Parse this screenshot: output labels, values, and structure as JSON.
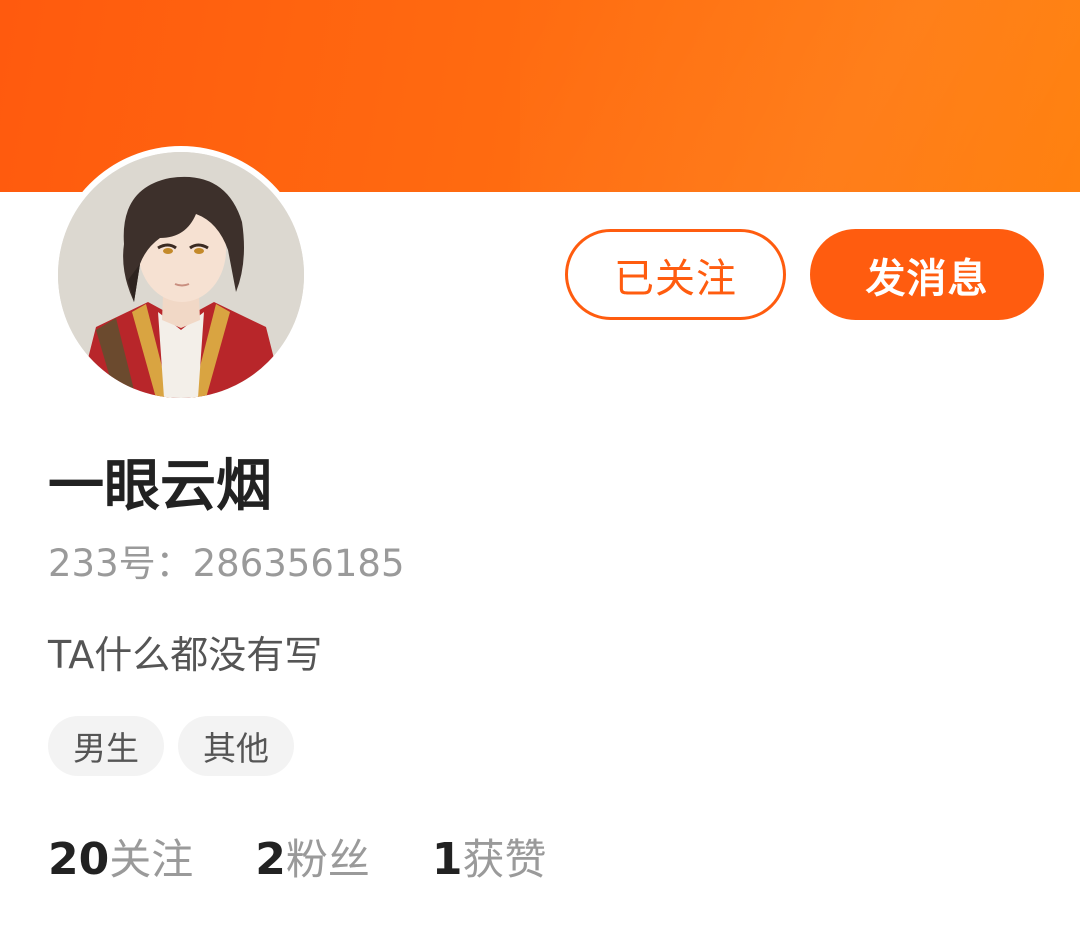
{
  "profile": {
    "username": "一眼云烟",
    "uid_text": "233号：286356185",
    "bio": "TA什么都没有写",
    "tags": [
      "男生",
      "其他"
    ]
  },
  "actions": {
    "followed_label": "已关注",
    "message_label": "发消息"
  },
  "stats": [
    {
      "value": "20",
      "label": "关注"
    },
    {
      "value": "2",
      "label": "粉丝"
    },
    {
      "value": "1",
      "label": "获赞"
    }
  ],
  "colors": {
    "accent": "#ff5c0f",
    "banner_start": "#ff5a0e",
    "banner_end": "#ff7e0a"
  },
  "icons": {
    "avatar": "anime-character-avatar"
  }
}
